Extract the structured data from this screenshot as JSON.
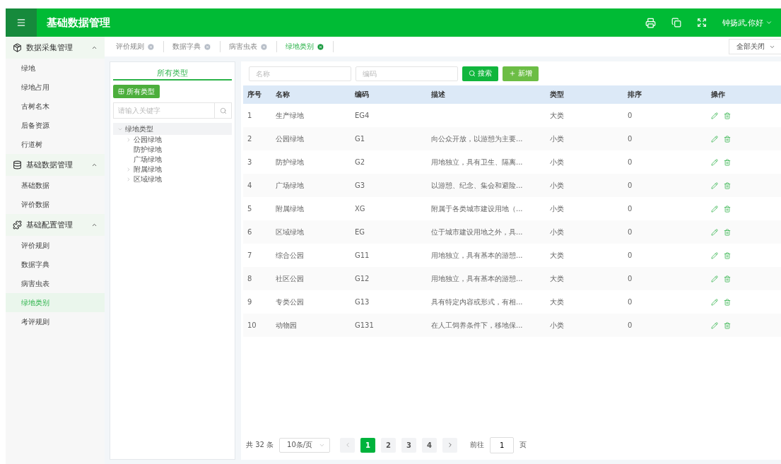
{
  "header": {
    "title": "基础数据管理",
    "user": "钟扬武,你好"
  },
  "tabs": [
    {
      "label": "评价规则",
      "selected": false
    },
    {
      "label": "数据字典",
      "selected": false
    },
    {
      "label": "病害虫表",
      "selected": false
    },
    {
      "label": "绿地类别",
      "selected": true
    }
  ],
  "close_all": "全部关闭",
  "sidebar": [
    {
      "label": "数据采集管理",
      "expanded": true,
      "items": [
        {
          "label": "绿地",
          "selected": false
        },
        {
          "label": "绿地占用",
          "selected": false
        },
        {
          "label": "古树名木",
          "selected": false
        },
        {
          "label": "后备资源",
          "selected": false
        },
        {
          "label": "行道树",
          "selected": false
        }
      ]
    },
    {
      "label": "基础数据管理",
      "expanded": true,
      "items": [
        {
          "label": "基础数据",
          "selected": false
        },
        {
          "label": "评价数据",
          "selected": false
        }
      ]
    },
    {
      "label": "基础配置管理",
      "expanded": true,
      "items": [
        {
          "label": "评价规则",
          "selected": false
        },
        {
          "label": "数据字典",
          "selected": false
        },
        {
          "label": "病害虫表",
          "selected": false
        },
        {
          "label": "绿地类别",
          "selected": true
        },
        {
          "label": "考评规则",
          "selected": false
        }
      ]
    }
  ],
  "tree_panel": {
    "tab": "所有类型",
    "all_button": "所有类型",
    "search_placeholder": "请输入关键字",
    "tree": [
      {
        "label": "绿地类型",
        "kind": "branch",
        "expanded": true,
        "children": [
          {
            "label": "公园绿地",
            "kind": "branch",
            "expanded": false
          },
          {
            "label": "防护绿地",
            "kind": "leaf",
            "expanded": false
          },
          {
            "label": "广场绿地",
            "kind": "leaf",
            "expanded": false
          },
          {
            "label": "附属绿地",
            "kind": "branch",
            "expanded": false
          },
          {
            "label": "区域绿地",
            "kind": "branch",
            "expanded": false
          }
        ]
      }
    ]
  },
  "filters": {
    "name_placeholder": "名称",
    "code_placeholder": "编码",
    "search_button": "搜索",
    "add_button": "新增"
  },
  "table": {
    "columns": [
      "序号",
      "名称",
      "编码",
      "描述",
      "类型",
      "排序",
      "操作"
    ],
    "rows": [
      [
        "1",
        "生产绿地",
        "EG4",
        "",
        "大类",
        "0"
      ],
      [
        "2",
        "公园绿地",
        "G1",
        "向公众开放，以游憩为主要...",
        "小类",
        "0"
      ],
      [
        "3",
        "防护绿地",
        "G2",
        "用地独立，具有卫生、隔离...",
        "小类",
        "0"
      ],
      [
        "4",
        "广场绿地",
        "G3",
        "以游憩、纪念、集会和避险...",
        "小类",
        "0"
      ],
      [
        "5",
        "附属绿地",
        "XG",
        "附属于各类城市建设用地（...",
        "小类",
        "0"
      ],
      [
        "6",
        "区域绿地",
        "EG",
        "位于城市建设用地之外，具...",
        "小类",
        "0"
      ],
      [
        "7",
        "综合公园",
        "G11",
        "用地独立，具有基本的游憩...",
        "大类",
        "0"
      ],
      [
        "8",
        "社区公园",
        "G12",
        "用地独立，具有基本的游憩...",
        "大类",
        "0"
      ],
      [
        "9",
        "专类公园",
        "G13",
        "具有特定内容或形式，有相...",
        "大类",
        "0"
      ],
      [
        "10",
        "动物园",
        "G131",
        "在人工饲养条件下，移地保...",
        "小类",
        "0"
      ]
    ]
  },
  "pagination": {
    "total": "共 32 条",
    "page_size": "10条/页",
    "pages": [
      {
        "label": "1",
        "selected": true
      },
      {
        "label": "2",
        "selected": false
      },
      {
        "label": "3",
        "selected": false
      },
      {
        "label": "4",
        "selected": false
      }
    ],
    "goto_label": "前往",
    "goto_value": "1",
    "page_unit": "页"
  }
}
